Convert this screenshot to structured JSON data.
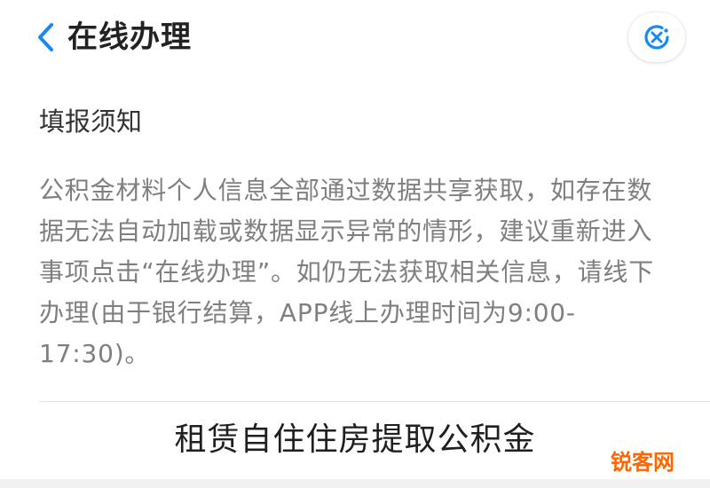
{
  "header": {
    "title": "在线办理",
    "back_icon": "chevron-left-icon",
    "close_icon": "close-mini-program-icon",
    "accent": "#1789f5"
  },
  "notice": {
    "heading": "填报须知",
    "body": "公积金材料个人信息全部通过数据共享获取，如存在数据无法自动加载或数据显示异常的情形，建议重新进入事项点击“在线办理”。如仍无法获取相关信息，请线下办理(由于银行结算，APP线上办理时间为9:00-17:30)。"
  },
  "item": {
    "label": "租赁自住住房提取公积金"
  },
  "watermark": {
    "text": "锐客网"
  }
}
